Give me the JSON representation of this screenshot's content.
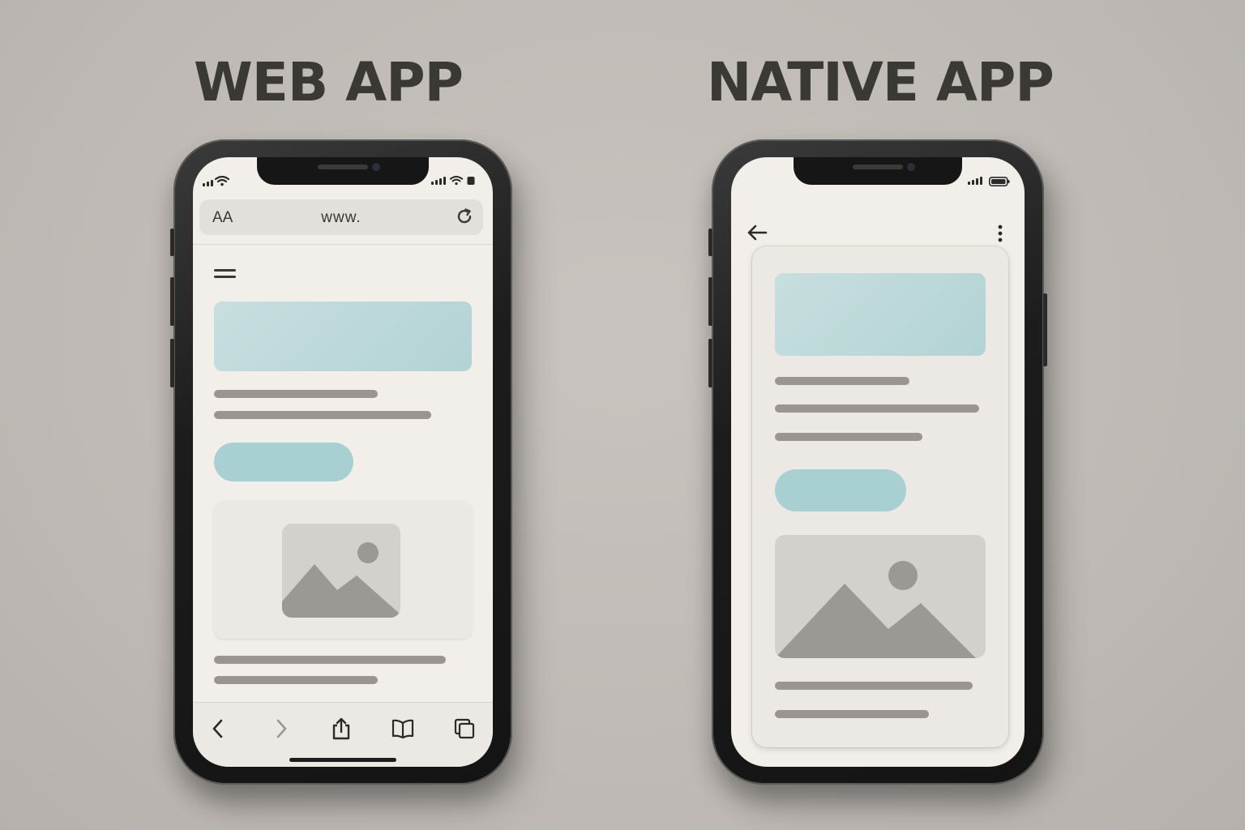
{
  "headings": {
    "web_app": "WEB APP",
    "native_app": "NATIVE APP"
  },
  "web_phone": {
    "browser": {
      "text_size_label": "AA",
      "url_text": "www."
    },
    "icons": [
      "signal-icon",
      "wifi-icon",
      "menu-icon",
      "reload-icon",
      "back-icon",
      "forward-icon",
      "share-icon",
      "bookmarks-icon",
      "tabs-icon",
      "image-placeholder-icon"
    ]
  },
  "native_phone": {
    "icons": [
      "signal-icon",
      "battery-icon",
      "back-arrow-icon",
      "more-options-icon",
      "image-placeholder-icon"
    ]
  },
  "colors": {
    "background": "#c0bbb6",
    "screen": "#f2eee9",
    "accent": "#a8cfd1",
    "placeholder_line": "#9a9591",
    "heading_text": "#3b3936"
  }
}
